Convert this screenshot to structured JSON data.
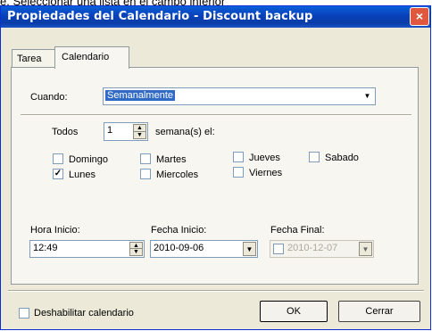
{
  "caption": "e. Seleccionar una lista en el campo inferior",
  "window": {
    "title": "Propiedades del Calendario - Discount backup",
    "close_glyph": "×"
  },
  "tabs": [
    {
      "label": "Tarea"
    },
    {
      "label": "Calendario"
    }
  ],
  "schedule": {
    "when_label": "Cuando:",
    "when_value": "Semanalmente",
    "every_label": "Todos",
    "every_value": "1",
    "every_suffix": "semana(s) el:"
  },
  "days": [
    {
      "label": "Domingo",
      "checked": false
    },
    {
      "label": "Lunes",
      "checked": true
    },
    {
      "label": "Martes",
      "checked": false
    },
    {
      "label": "Miercoles",
      "checked": false
    },
    {
      "label": "Jueves",
      "checked": false
    },
    {
      "label": "Viernes",
      "checked": false
    },
    {
      "label": "Sabado",
      "checked": false
    }
  ],
  "check_mark": "✓",
  "time": {
    "start_time_label": "Hora Inicio:",
    "start_time_value": "12:49",
    "start_date_label": "Fecha Inicio:",
    "start_date_value": "2010-09-06",
    "end_date_label": "Fecha Final:",
    "end_date_value": "2010-12-07"
  },
  "footer": {
    "disable_label": "Deshabilitar calendario",
    "disable_checked": false,
    "ok_label": "OK",
    "close_label": "Cerrar"
  }
}
